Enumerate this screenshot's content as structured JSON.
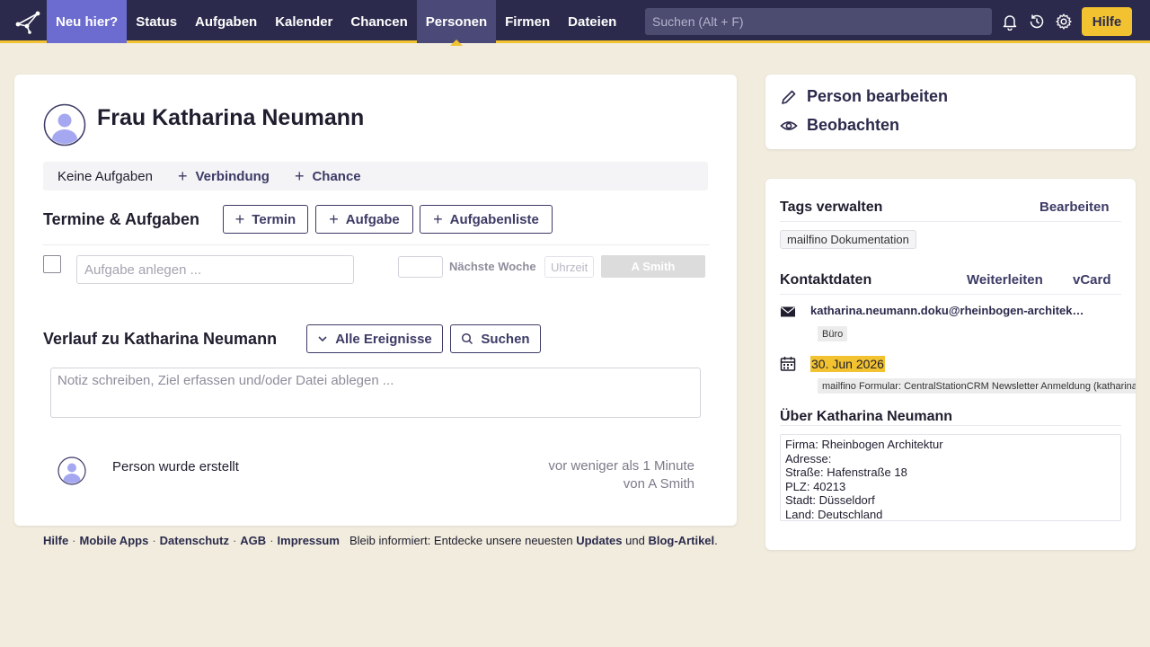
{
  "nav": {
    "items": [
      {
        "label": "Neu hier?"
      },
      {
        "label": "Status"
      },
      {
        "label": "Aufgaben"
      },
      {
        "label": "Kalender"
      },
      {
        "label": "Chancen"
      },
      {
        "label": "Personen"
      },
      {
        "label": "Firmen"
      },
      {
        "label": "Dateien"
      }
    ],
    "active": "Personen",
    "search_placeholder": "Suchen (Alt + F)",
    "help_label": "Hilfe"
  },
  "person": {
    "name": "Frau Katharina Neumann"
  },
  "quickbar": {
    "no_tasks": "Keine Aufgaben",
    "connection": "Verbindung",
    "chance": "Chance"
  },
  "tasks": {
    "title": "Termine & Aufgaben",
    "btn_appointment": "Termin",
    "btn_task": "Aufgabe",
    "btn_tasklist": "Aufgabenliste",
    "input_placeholder": "Aufgabe anlegen ...",
    "next_week": "Nächste Woche",
    "time_placeholder": "Uhrzeit",
    "assignee": "A Smith"
  },
  "history": {
    "title": "Verlauf zu Katharina Neumann",
    "filter": "Alle Ereignisse",
    "search": "Suchen",
    "note_placeholder": "Notiz schreiben, Ziel erfassen und/oder Datei ablegen ...",
    "event_text": "Person wurde erstellt",
    "event_time_1": "vor weniger als 1 Minute",
    "event_time_2": "von A Smith"
  },
  "footer": {
    "links": [
      "Hilfe",
      "Mobile Apps",
      "Datenschutz",
      "AGB",
      "Impressum"
    ],
    "info_prefix": "Bleib informiert: Entdecke unsere neuesten",
    "updates": "Updates",
    "and": "und",
    "blog": "Blog-Artikel",
    "dot": "."
  },
  "actions": {
    "edit": "Person bearbeiten",
    "watch": "Beobachten"
  },
  "tags": {
    "title": "Tags verwalten",
    "edit": "Bearbeiten",
    "items": [
      "mailfino Dokumentation"
    ]
  },
  "contact": {
    "title": "Kontaktdaten",
    "forward": "Weiterleiten",
    "vcard": "vCard",
    "email": "katharina.neumann.doku@rheinbogen-architektur.de",
    "email_type": "Büro",
    "date": "30. Jun 2026",
    "date_source": "mailfino Formular: CentralStationCRM Newsletter Anmeldung (katharina"
  },
  "about": {
    "title": "Über Katharina Neumann",
    "lines": [
      "Firma: Rheinbogen Architektur",
      "Adresse:",
      "Straße: Hafenstraße 18",
      "PLZ: 40213",
      "Stadt: Düsseldorf",
      "Land: Deutschland"
    ]
  },
  "colors": {
    "nav_bg": "#2b2a4c",
    "accent_yellow": "#f2c230",
    "page_bg": "#f1ecde",
    "link": "#3c3b66"
  }
}
